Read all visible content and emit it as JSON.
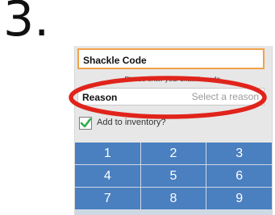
{
  "step": {
    "number": "3."
  },
  "form": {
    "shackle_label": "Shackle Code",
    "hint": "Please enter your shackle code.",
    "reason_label": "Reason",
    "reason_placeholder": "Select a reason",
    "checkbox_label": "Add to inventory?",
    "checkbox_checked": true
  },
  "keypad": {
    "keys": [
      "1",
      "2",
      "3",
      "4",
      "5",
      "6",
      "7",
      "8",
      "9"
    ]
  },
  "colors": {
    "accent_orange": "#f2a24a",
    "keypad_blue": "#4a7fc0",
    "highlight_red": "#e0241b",
    "check_green": "#2eae4b"
  },
  "annotation": {
    "shape": "ellipse",
    "color": "red",
    "target": "reason-row"
  }
}
